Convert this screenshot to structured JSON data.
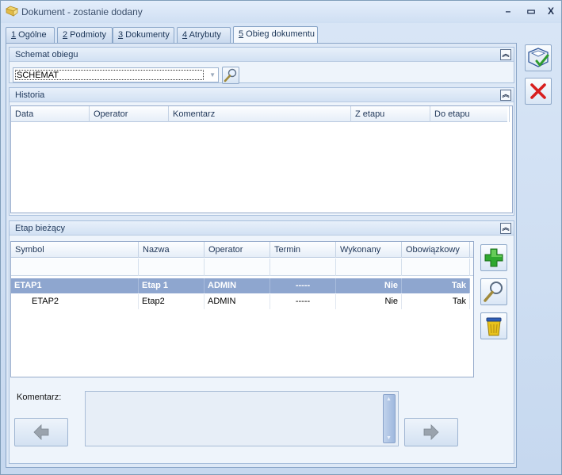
{
  "window": {
    "title": "Dokument - zostanie dodany",
    "controls": {
      "minimize": "–",
      "maximize": "▭",
      "close": "X"
    }
  },
  "tabs": [
    {
      "key": "1",
      "label": " Ogólne"
    },
    {
      "key": "2",
      "label": " Podmioty"
    },
    {
      "key": "3",
      "label": " Dokumenty"
    },
    {
      "key": "4",
      "label": " Atrybuty"
    },
    {
      "key": "5",
      "label": " Obieg dokumentu",
      "active": true
    }
  ],
  "schemat": {
    "title": "Schemat obiegu",
    "value": "SCHEMAT"
  },
  "historia": {
    "title": "Historia",
    "columns": [
      "Data",
      "Operator",
      "Komentarz",
      "Z etapu",
      "Do etapu"
    ]
  },
  "etap": {
    "title": "Etap bieżący",
    "columns": [
      "Symbol",
      "Nazwa",
      "Operator",
      "Termin",
      "Wykonany",
      "Obowiązkowy"
    ],
    "rows": [
      {
        "symbol": "ETAP1",
        "nazwa": "Etap 1",
        "operator": "ADMIN",
        "termin": "-----",
        "wykonany": "Nie",
        "obowiazkowy": "Tak",
        "selected": true
      },
      {
        "symbol": "ETAP2",
        "nazwa": "Etap2",
        "operator": "ADMIN",
        "termin": "-----",
        "wykonany": "Nie",
        "obowiazkowy": "Tak",
        "selected": false
      }
    ]
  },
  "komentarz": {
    "label": "Komentarz:",
    "value": ""
  },
  "icons": {
    "save": "save-icon",
    "cancel": "cancel-icon",
    "add": "plus-icon",
    "search": "magnifier-icon",
    "delete": "trash-icon",
    "prev": "arrow-left-icon",
    "next": "arrow-right-icon"
  },
  "colors": {
    "selected_row": "#8ea6cf",
    "add_green": "#2fa82f",
    "cancel_red": "#d81e1e",
    "trash_yellow": "#e8c21c"
  }
}
